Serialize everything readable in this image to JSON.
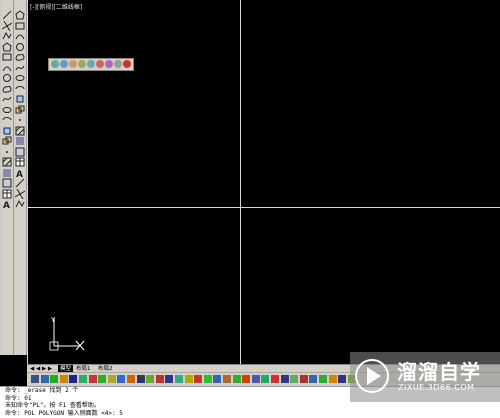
{
  "viewport": {
    "label": "[-][俯视][二维线框]"
  },
  "tabs": {
    "nav": "◀ ◀ ▶ ▶",
    "model": "模型",
    "layout1": "布局1",
    "layout2": "布局2"
  },
  "command_lines": [
    "命令: _erase 找到 2 个",
    "命令: 01",
    "未知命令\"PL\"。按 F1 查看帮助。",
    "命令: POL POLYGON 输入侧面数 <4>: 5"
  ],
  "watermark": {
    "name": "溜溜自学",
    "url": "ZIXUE.3D66.COM"
  },
  "colors": {
    "canvas": "#000000",
    "toolbar": "#d4d0c8",
    "viewport_border": "#d8d8d8",
    "watermark_bg": "#8a8a8a"
  },
  "icons": {
    "left_toolbar": [
      "line-icon",
      "construction-line-icon",
      "polyline-icon",
      "polygon-icon",
      "rectangle-icon",
      "arc-icon",
      "circle-icon",
      "revision-cloud-icon",
      "spline-icon",
      "ellipse-icon",
      "ellipse-arc-icon",
      "insert-block-icon",
      "make-block-icon",
      "point-icon",
      "hatch-icon",
      "gradient-icon",
      "region-icon",
      "table-icon",
      "multiline-text-icon"
    ],
    "float_toolbar": [
      "zoom-window-icon",
      "zoom-dynamic-icon",
      "zoom-scale-icon",
      "zoom-center-icon",
      "zoom-object-icon",
      "zoom-in-icon",
      "zoom-out-icon",
      "zoom-all-icon",
      "zoom-extents-icon"
    ]
  }
}
